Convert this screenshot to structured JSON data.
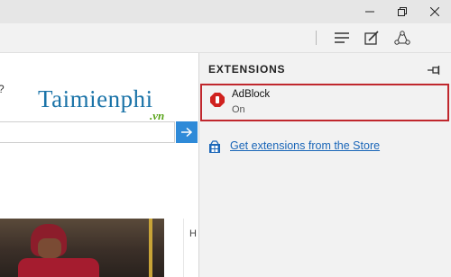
{
  "window": {
    "minimize_icon": "minimize-icon",
    "restore_icon": "restore-icon",
    "close_icon": "close-icon"
  },
  "toolbar": {
    "icons": [
      "hub-icon",
      "web-note-icon",
      "share-icon"
    ]
  },
  "page": {
    "logo_main": "Taimienphi",
    "logo_suffix": ".vn",
    "stray_char": "?",
    "edge_char": "H"
  },
  "extensions_panel": {
    "title": "EXTENSIONS",
    "pin_icon": "pin-icon",
    "items": [
      {
        "name": "AdBlock",
        "state": "On",
        "icon": "adblock-icon"
      }
    ],
    "store_link": "Get extensions from the Store",
    "store_icon": "store-icon"
  },
  "colors": {
    "highlight_border": "#c0272d",
    "link": "#1a66b8",
    "accent": "#2e8ad8"
  }
}
